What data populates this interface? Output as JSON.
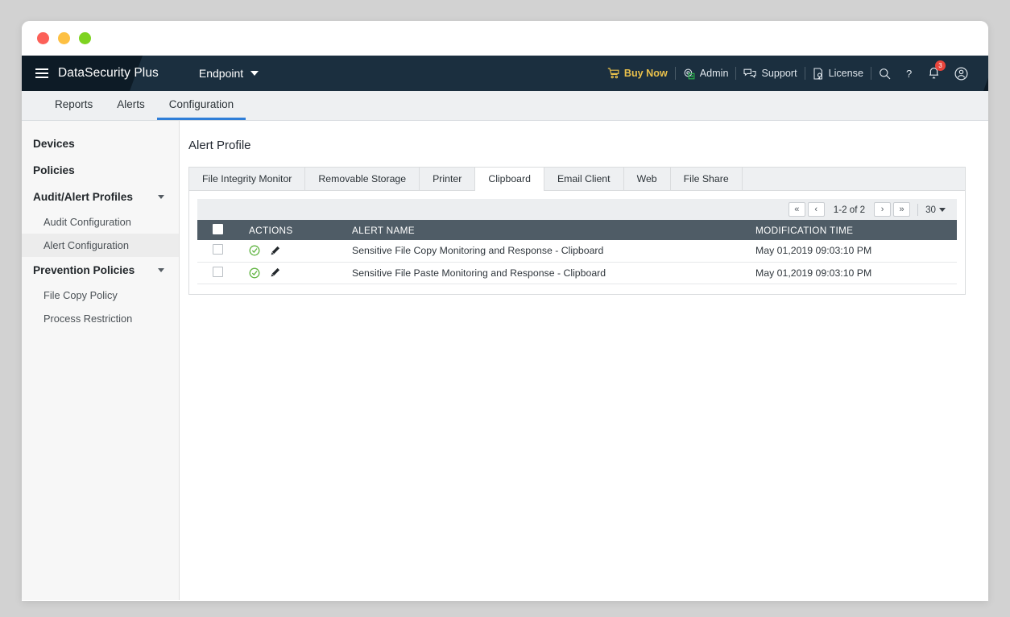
{
  "window": {
    "traffic_lights": [
      "close",
      "minimize",
      "maximize"
    ]
  },
  "header": {
    "menu_icon": "hamburger-icon",
    "brand": "DataSecurity Plus",
    "product": "Endpoint",
    "product_caret": "chevron-down-icon",
    "right_items": [
      {
        "label": "Buy Now",
        "icon": "cart-icon"
      },
      {
        "label": "Admin",
        "icon": "admin-gear-icon"
      },
      {
        "label": "Support",
        "icon": "chat-icon"
      },
      {
        "label": "License",
        "icon": "license-icon"
      }
    ],
    "search_icon": "search-icon",
    "help_icon": "help-question-icon",
    "notification_icon": "bell-icon",
    "notification_count": "3",
    "profile_icon": "user-avatar-icon",
    "accent_buy_now_color": "#e9c04b",
    "badge_color": "#e8453c",
    "bg_color": "#0d1b26"
  },
  "mainnav": {
    "tabs": [
      {
        "label": "Reports",
        "active": false
      },
      {
        "label": "Alerts",
        "active": false
      },
      {
        "label": "Configuration",
        "active": true
      }
    ],
    "active_underline_color": "#2f7ed8"
  },
  "sidebar": {
    "items": [
      {
        "label": "Devices",
        "type": "group",
        "expandable": false
      },
      {
        "label": "Policies",
        "type": "group",
        "expandable": false
      },
      {
        "label": "Audit/Alert Profiles",
        "type": "group",
        "expandable": true
      },
      {
        "label": "Audit Configuration",
        "type": "sub",
        "active": false
      },
      {
        "label": "Alert Configuration",
        "type": "sub",
        "active": true
      },
      {
        "label": "Prevention Policies",
        "type": "group",
        "expandable": true
      },
      {
        "label": "File Copy Policy",
        "type": "sub",
        "active": false
      },
      {
        "label": "Process Restriction",
        "type": "sub",
        "active": false
      }
    ]
  },
  "main": {
    "page_title": "Alert Profile",
    "tabs": [
      {
        "label": "File Integrity Monitor",
        "active": false
      },
      {
        "label": "Removable Storage",
        "active": false
      },
      {
        "label": "Printer",
        "active": false
      },
      {
        "label": "Clipboard",
        "active": true
      },
      {
        "label": "Email Client",
        "active": false
      },
      {
        "label": "Web",
        "active": false
      },
      {
        "label": "File Share",
        "active": false
      }
    ],
    "pagination": {
      "first": "«",
      "prev": "‹",
      "range": "1-2 of 2",
      "next": "›",
      "last": "»",
      "page_size": "30"
    },
    "table": {
      "columns": [
        "",
        "ACTIONS",
        "ALERT NAME",
        "MODIFICATION TIME"
      ],
      "header_bg": "#4f5c66",
      "rows": [
        {
          "selected": false,
          "actions": [
            "enabled-check-icon",
            "edit-pencil-icon"
          ],
          "alert_name": "Sensitive File Copy Monitoring and Response - Clipboard",
          "modification_time": "May 01,2019 09:03:10 PM"
        },
        {
          "selected": false,
          "actions": [
            "enabled-check-icon",
            "edit-pencil-icon"
          ],
          "alert_name": "Sensitive File Paste Monitoring and Response - Clipboard",
          "modification_time": "May 01,2019 09:03:10 PM"
        }
      ]
    }
  }
}
